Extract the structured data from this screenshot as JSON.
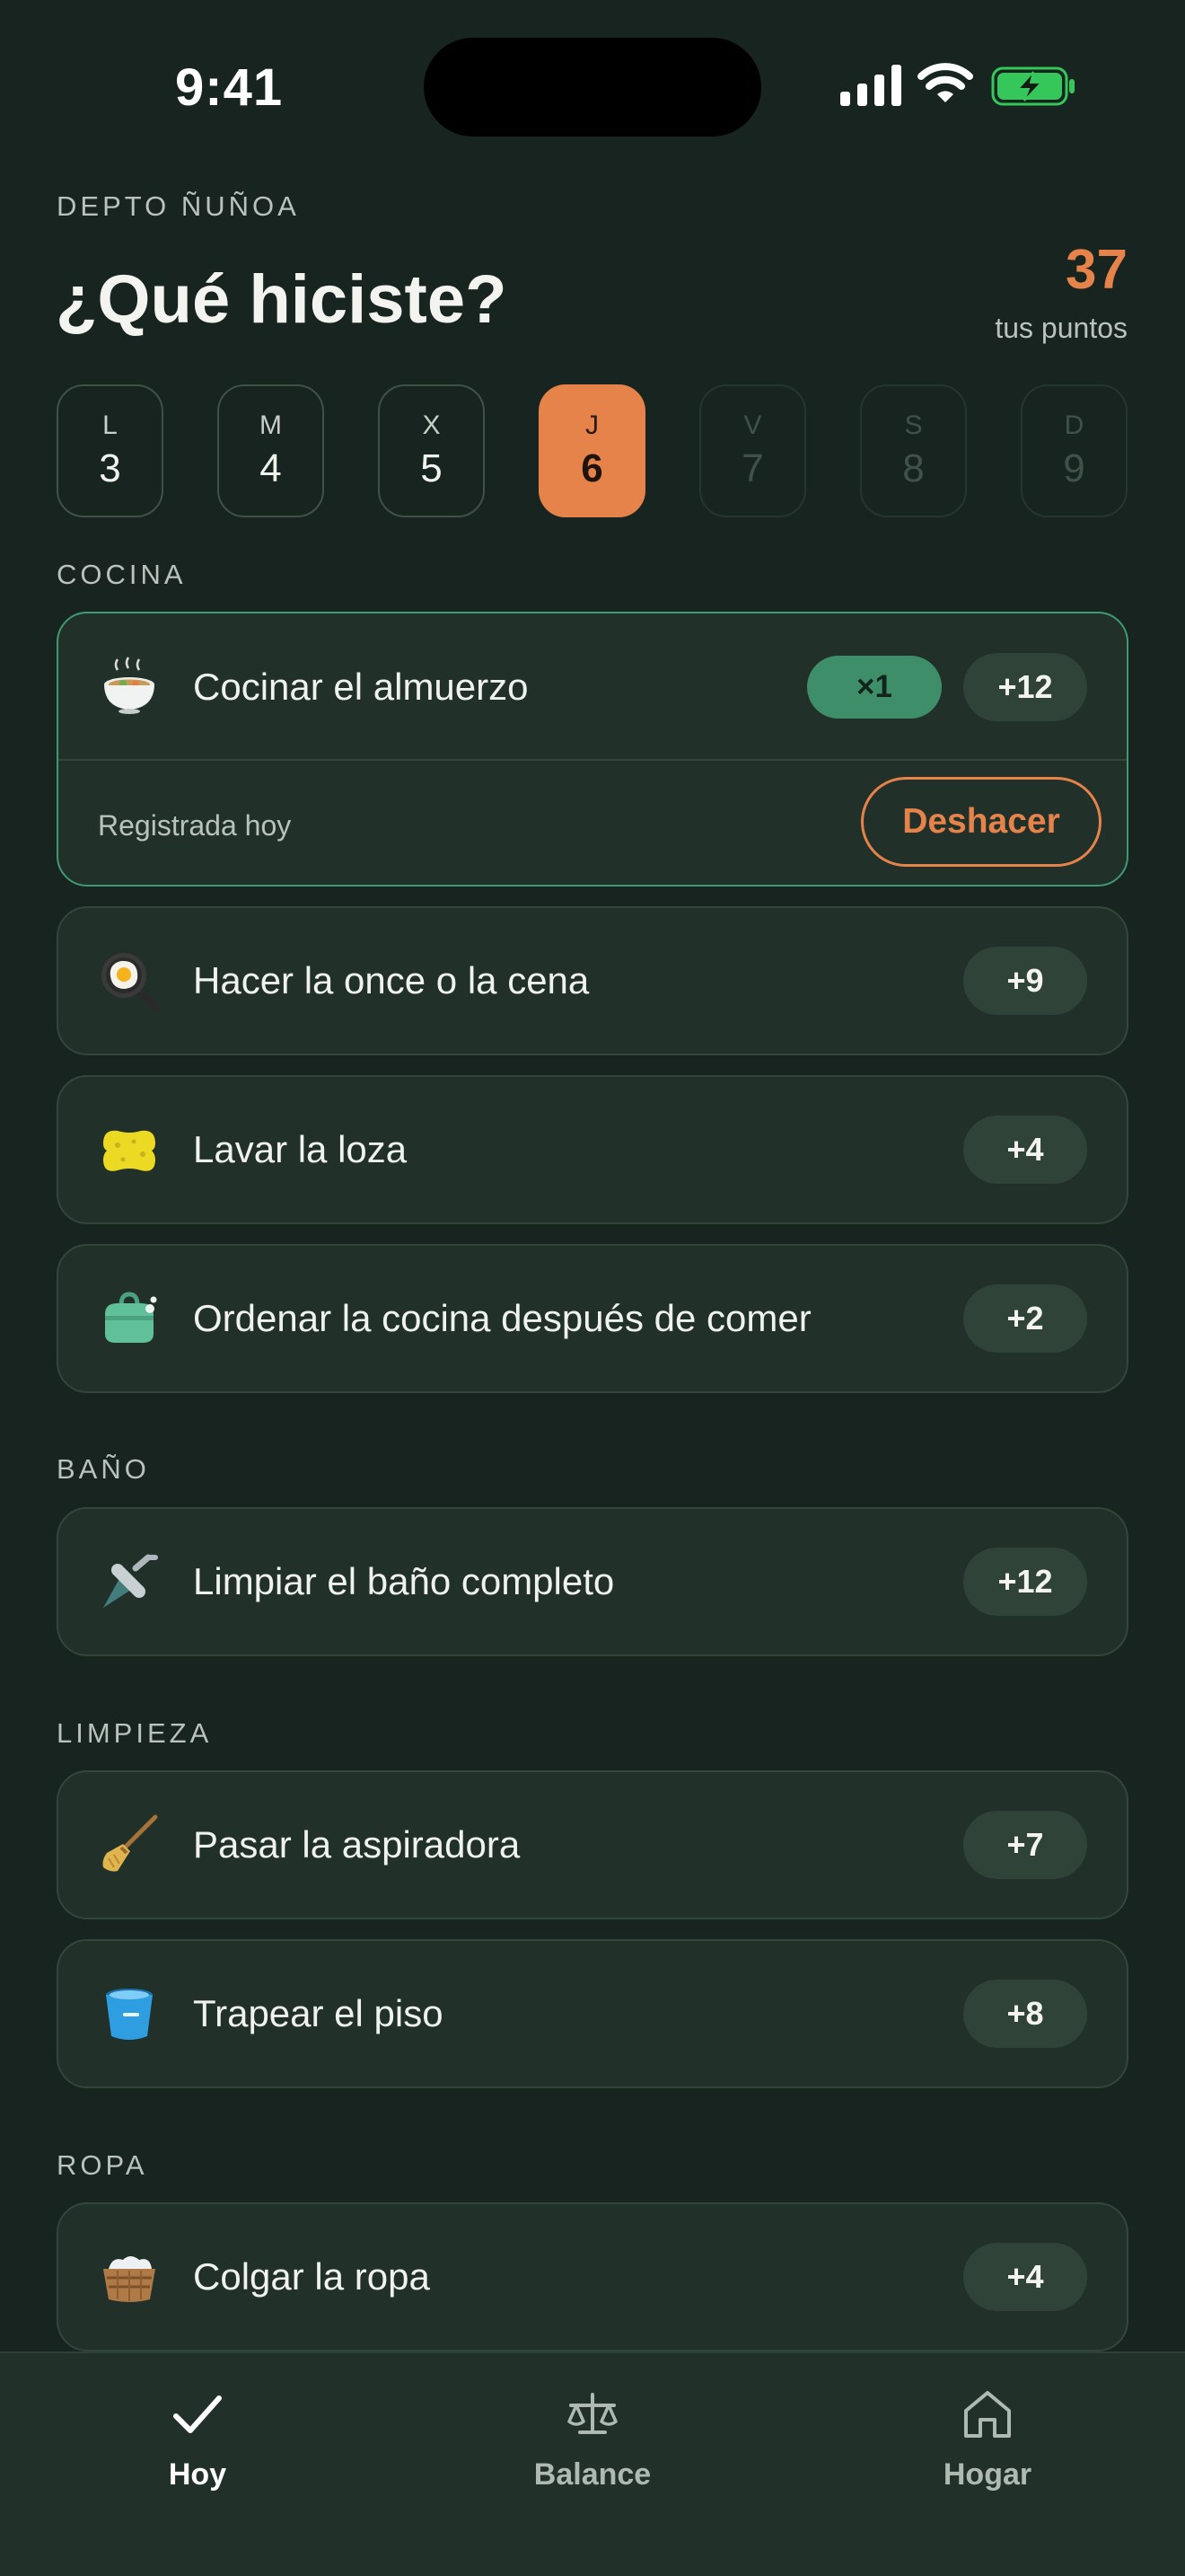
{
  "status_bar": {
    "time": "9:41"
  },
  "header": {
    "household": "DEPTO ÑUÑOA",
    "title": "¿Qué hiciste?",
    "points_value": "37",
    "points_label": "tus puntos"
  },
  "days": [
    {
      "letter": "L",
      "number": "3",
      "state": "normal"
    },
    {
      "letter": "M",
      "number": "4",
      "state": "normal"
    },
    {
      "letter": "X",
      "number": "5",
      "state": "normal"
    },
    {
      "letter": "J",
      "number": "6",
      "state": "active"
    },
    {
      "letter": "V",
      "number": "7",
      "state": "disabled"
    },
    {
      "letter": "S",
      "number": "8",
      "state": "disabled"
    },
    {
      "letter": "D",
      "number": "9",
      "state": "disabled"
    }
  ],
  "sections": {
    "cocina": {
      "label": "COCINA",
      "tasks": [
        {
          "name": "Cocinar el almuerzo",
          "points": "+12",
          "count": "×1",
          "icon": "bowl-icon",
          "logged_text": "Registrada hoy",
          "undo_label": "Deshacer"
        },
        {
          "name": "Hacer la once o la cena",
          "points": "+9",
          "icon": "frying-pan-icon"
        },
        {
          "name": "Lavar la loza",
          "points": "+4",
          "icon": "sponge-icon"
        },
        {
          "name": "Ordenar la cocina después de comer",
          "points": "+2",
          "icon": "cleaning-bag-icon"
        }
      ]
    },
    "bano": {
      "label": "BAÑO",
      "tasks": [
        {
          "name": "Limpiar el baño completo",
          "points": "+12",
          "icon": "shower-icon"
        }
      ]
    },
    "limpieza": {
      "label": "LIMPIEZA",
      "tasks": [
        {
          "name": "Pasar la aspiradora",
          "points": "+7",
          "icon": "broom-icon"
        },
        {
          "name": "Trapear el piso",
          "points": "+8",
          "icon": "bucket-icon"
        }
      ]
    },
    "ropa": {
      "label": "ROPA",
      "tasks": [
        {
          "name": "Colgar la ropa",
          "points": "+4",
          "icon": "laundry-basket-icon"
        }
      ]
    }
  },
  "tabbar": {
    "tabs": [
      {
        "label": "Hoy",
        "icon": "checkmark-icon",
        "active": true
      },
      {
        "label": "Balance",
        "icon": "scale-icon",
        "active": false
      },
      {
        "label": "Hogar",
        "icon": "home-icon",
        "active": false
      }
    ]
  },
  "colors": {
    "background": "#18241f",
    "card": "#213129",
    "accent_orange": "#e5834b",
    "accent_green": "#3f8e6a"
  }
}
